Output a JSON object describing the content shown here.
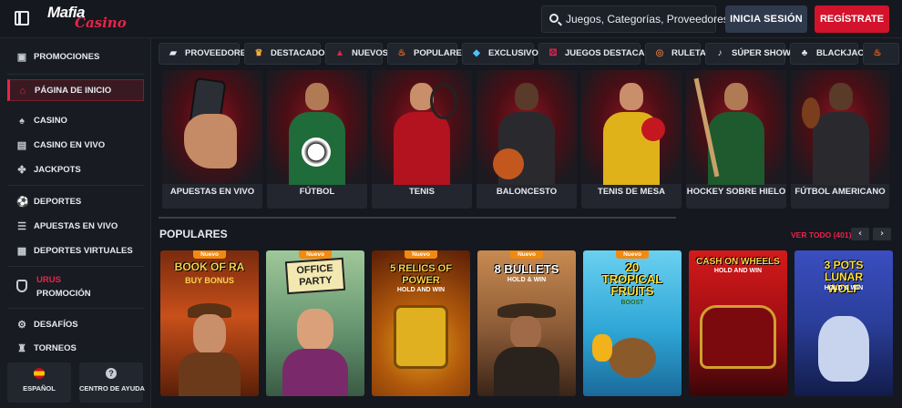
{
  "header": {
    "logo_line1": "Mafia",
    "logo_line2": "Casino",
    "search_placeholder": "Juegos, Categorías, Proveedores",
    "login_label": "INICIA SESIÓN",
    "register_label": "REGÍSTRATE"
  },
  "sidebar": {
    "items": [
      {
        "label": "PROMOCIONES",
        "icon": "gift-icon"
      },
      {
        "label": "PÁGINA DE INICIO",
        "icon": "home-icon"
      },
      {
        "label": "CASINO",
        "icon": "spade-icon"
      },
      {
        "label": "CASINO EN VIVO",
        "icon": "live-casino-icon"
      },
      {
        "label": "JACKPOTS",
        "icon": "jackpot-icon"
      },
      {
        "label": "DEPORTES",
        "icon": "soccer-ball-icon"
      },
      {
        "label": "APUESTAS EN VIVO",
        "icon": "live-bets-icon"
      },
      {
        "label": "DEPORTES VIRTUALES",
        "icon": "virtual-sports-icon"
      },
      {
        "label": "DESAFÍOS",
        "icon": "gear-icon"
      },
      {
        "label": "TORNEOS",
        "icon": "trophy-icon"
      }
    ],
    "urus_title": "URUS",
    "urus_sub": "PROMOCIÓN",
    "language_label": "ESPAÑOL",
    "help_label": "CENTRO DE AYUDA"
  },
  "categories": [
    {
      "label": "PROVEEDORES",
      "icon": "providers-icon"
    },
    {
      "label": "DESTACADOS",
      "icon": "crown-icon"
    },
    {
      "label": "NUEVOS",
      "icon": "new-icon"
    },
    {
      "label": "POPULARES",
      "icon": "fire-icon"
    },
    {
      "label": "EXCLUSIVOS",
      "icon": "diamond-icon"
    },
    {
      "label": "JUEGOS DESTACADOS",
      "icon": "dice-icon"
    },
    {
      "label": "RULETA",
      "icon": "roulette-icon"
    },
    {
      "label": "SÚPER SHOWS",
      "icon": "microphone-icon"
    },
    {
      "label": "BLACKJACK",
      "icon": "cards-icon"
    },
    {
      "label": "",
      "icon": "fire-icon"
    }
  ],
  "sports": [
    {
      "label": "APUESTAS EN VIVO"
    },
    {
      "label": "FÚTBOL"
    },
    {
      "label": "TENIS"
    },
    {
      "label": "BALONCESTO"
    },
    {
      "label": "TENIS DE MESA"
    },
    {
      "label": "HOCKEY SOBRE HIELO"
    },
    {
      "label": "FÚTBOL AMERICANO"
    }
  ],
  "popular": {
    "title": "POPULARES",
    "view_all": "VER TODO (401)",
    "badge": "Nuevo",
    "games": [
      {
        "title": "BOOK OF RA",
        "subtitle": "BUY BONUS",
        "bg": "#c8501a"
      },
      {
        "title": "OFFICE PARTY",
        "subtitle": "",
        "bg": "#5f8f6a"
      },
      {
        "title": "5 RELICS OF POWER",
        "subtitle": "HOLD AND WIN",
        "bg": "#b25a0c"
      },
      {
        "title": "8 BULLETS",
        "subtitle": "HOLD & WIN",
        "bg": "#8a5a36"
      },
      {
        "title": "20 TROPICAL FRUITS",
        "subtitle": "BOOST",
        "bg": "#2ea6d6"
      },
      {
        "title": "CASH ON WHEELS",
        "subtitle": "HOLD AND WIN",
        "bg": "#9b0d12"
      },
      {
        "title": "3 POTS LUNAR WOLF",
        "subtitle": "HOLD & WIN",
        "bg": "#2a3e9a"
      }
    ]
  },
  "colors": {
    "accent": "#e8244a",
    "register": "#d3122c",
    "badge": "#f18a12"
  }
}
